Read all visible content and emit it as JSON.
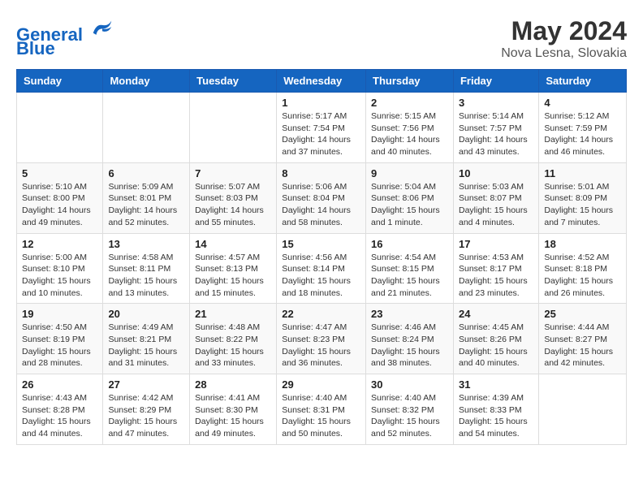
{
  "header": {
    "logo_line1": "General",
    "logo_line2": "Blue",
    "main_title": "May 2024",
    "subtitle": "Nova Lesna, Slovakia"
  },
  "weekdays": [
    "Sunday",
    "Monday",
    "Tuesday",
    "Wednesday",
    "Thursday",
    "Friday",
    "Saturday"
  ],
  "weeks": [
    [
      {
        "day": "",
        "info": ""
      },
      {
        "day": "",
        "info": ""
      },
      {
        "day": "",
        "info": ""
      },
      {
        "day": "1",
        "info": "Sunrise: 5:17 AM\nSunset: 7:54 PM\nDaylight: 14 hours\nand 37 minutes."
      },
      {
        "day": "2",
        "info": "Sunrise: 5:15 AM\nSunset: 7:56 PM\nDaylight: 14 hours\nand 40 minutes."
      },
      {
        "day": "3",
        "info": "Sunrise: 5:14 AM\nSunset: 7:57 PM\nDaylight: 14 hours\nand 43 minutes."
      },
      {
        "day": "4",
        "info": "Sunrise: 5:12 AM\nSunset: 7:59 PM\nDaylight: 14 hours\nand 46 minutes."
      }
    ],
    [
      {
        "day": "5",
        "info": "Sunrise: 5:10 AM\nSunset: 8:00 PM\nDaylight: 14 hours\nand 49 minutes."
      },
      {
        "day": "6",
        "info": "Sunrise: 5:09 AM\nSunset: 8:01 PM\nDaylight: 14 hours\nand 52 minutes."
      },
      {
        "day": "7",
        "info": "Sunrise: 5:07 AM\nSunset: 8:03 PM\nDaylight: 14 hours\nand 55 minutes."
      },
      {
        "day": "8",
        "info": "Sunrise: 5:06 AM\nSunset: 8:04 PM\nDaylight: 14 hours\nand 58 minutes."
      },
      {
        "day": "9",
        "info": "Sunrise: 5:04 AM\nSunset: 8:06 PM\nDaylight: 15 hours\nand 1 minute."
      },
      {
        "day": "10",
        "info": "Sunrise: 5:03 AM\nSunset: 8:07 PM\nDaylight: 15 hours\nand 4 minutes."
      },
      {
        "day": "11",
        "info": "Sunrise: 5:01 AM\nSunset: 8:09 PM\nDaylight: 15 hours\nand 7 minutes."
      }
    ],
    [
      {
        "day": "12",
        "info": "Sunrise: 5:00 AM\nSunset: 8:10 PM\nDaylight: 15 hours\nand 10 minutes."
      },
      {
        "day": "13",
        "info": "Sunrise: 4:58 AM\nSunset: 8:11 PM\nDaylight: 15 hours\nand 13 minutes."
      },
      {
        "day": "14",
        "info": "Sunrise: 4:57 AM\nSunset: 8:13 PM\nDaylight: 15 hours\nand 15 minutes."
      },
      {
        "day": "15",
        "info": "Sunrise: 4:56 AM\nSunset: 8:14 PM\nDaylight: 15 hours\nand 18 minutes."
      },
      {
        "day": "16",
        "info": "Sunrise: 4:54 AM\nSunset: 8:15 PM\nDaylight: 15 hours\nand 21 minutes."
      },
      {
        "day": "17",
        "info": "Sunrise: 4:53 AM\nSunset: 8:17 PM\nDaylight: 15 hours\nand 23 minutes."
      },
      {
        "day": "18",
        "info": "Sunrise: 4:52 AM\nSunset: 8:18 PM\nDaylight: 15 hours\nand 26 minutes."
      }
    ],
    [
      {
        "day": "19",
        "info": "Sunrise: 4:50 AM\nSunset: 8:19 PM\nDaylight: 15 hours\nand 28 minutes."
      },
      {
        "day": "20",
        "info": "Sunrise: 4:49 AM\nSunset: 8:21 PM\nDaylight: 15 hours\nand 31 minutes."
      },
      {
        "day": "21",
        "info": "Sunrise: 4:48 AM\nSunset: 8:22 PM\nDaylight: 15 hours\nand 33 minutes."
      },
      {
        "day": "22",
        "info": "Sunrise: 4:47 AM\nSunset: 8:23 PM\nDaylight: 15 hours\nand 36 minutes."
      },
      {
        "day": "23",
        "info": "Sunrise: 4:46 AM\nSunset: 8:24 PM\nDaylight: 15 hours\nand 38 minutes."
      },
      {
        "day": "24",
        "info": "Sunrise: 4:45 AM\nSunset: 8:26 PM\nDaylight: 15 hours\nand 40 minutes."
      },
      {
        "day": "25",
        "info": "Sunrise: 4:44 AM\nSunset: 8:27 PM\nDaylight: 15 hours\nand 42 minutes."
      }
    ],
    [
      {
        "day": "26",
        "info": "Sunrise: 4:43 AM\nSunset: 8:28 PM\nDaylight: 15 hours\nand 44 minutes."
      },
      {
        "day": "27",
        "info": "Sunrise: 4:42 AM\nSunset: 8:29 PM\nDaylight: 15 hours\nand 47 minutes."
      },
      {
        "day": "28",
        "info": "Sunrise: 4:41 AM\nSunset: 8:30 PM\nDaylight: 15 hours\nand 49 minutes."
      },
      {
        "day": "29",
        "info": "Sunrise: 4:40 AM\nSunset: 8:31 PM\nDaylight: 15 hours\nand 50 minutes."
      },
      {
        "day": "30",
        "info": "Sunrise: 4:40 AM\nSunset: 8:32 PM\nDaylight: 15 hours\nand 52 minutes."
      },
      {
        "day": "31",
        "info": "Sunrise: 4:39 AM\nSunset: 8:33 PM\nDaylight: 15 hours\nand 54 minutes."
      },
      {
        "day": "",
        "info": ""
      }
    ]
  ]
}
